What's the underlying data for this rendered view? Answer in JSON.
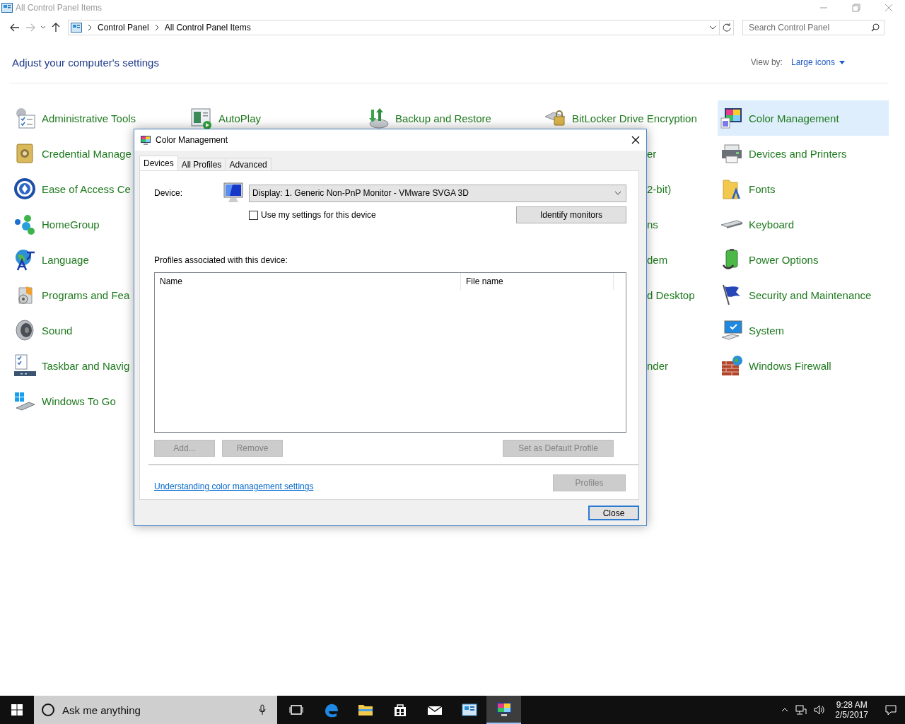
{
  "window": {
    "title": "All Control Panel Items"
  },
  "address_bar": {
    "breadcrumbs": [
      "Control Panel",
      "All Control Panel Items"
    ]
  },
  "search": {
    "placeholder": "Search Control Panel"
  },
  "heading": "Adjust your computer's settings",
  "view_by": {
    "label": "View by:",
    "value": "Large icons"
  },
  "rows": [
    {
      "cells": [
        {
          "label": "Administrative Tools",
          "kind": "item",
          "selected": false
        },
        {
          "label": "AutoPlay",
          "kind": "item",
          "selected": false
        },
        {
          "label": "Backup and Restore",
          "kind": "item",
          "selected": false
        },
        {
          "label": "BitLocker Drive Encryption",
          "kind": "item",
          "selected": false
        },
        {
          "label": "Color Management",
          "kind": "item",
          "selected": true
        }
      ]
    },
    {
      "cells": [
        {
          "label": "Credential Manage",
          "kind": "item",
          "selected": false
        },
        null,
        null,
        {
          "label": "er",
          "kind": "fragment",
          "selected": false
        },
        {
          "label": "Devices and Printers",
          "kind": "item",
          "selected": false
        }
      ]
    },
    {
      "cells": [
        {
          "label": "Ease of Access Ce",
          "kind": "item",
          "selected": false
        },
        null,
        null,
        {
          "label": "2-bit)",
          "kind": "fragment",
          "selected": false
        },
        {
          "label": "Fonts",
          "kind": "item",
          "selected": false
        }
      ]
    },
    {
      "cells": [
        {
          "label": "HomeGroup",
          "kind": "item",
          "selected": false
        },
        null,
        null,
        {
          "label": "ns",
          "kind": "fragment",
          "selected": false
        },
        {
          "label": "Keyboard",
          "kind": "item",
          "selected": false
        }
      ]
    },
    {
      "cells": [
        {
          "label": "Language",
          "kind": "item",
          "selected": false
        },
        null,
        null,
        {
          "label": "dem",
          "kind": "fragment",
          "selected": false
        },
        {
          "label": "Power Options",
          "kind": "item",
          "selected": false
        }
      ]
    },
    {
      "cells": [
        {
          "label": "Programs and Fea",
          "kind": "item",
          "selected": false
        },
        null,
        null,
        {
          "label": "d Desktop",
          "kind": "fragment",
          "selected": false
        },
        {
          "label": "Security and Maintenance",
          "kind": "item",
          "selected": false
        }
      ]
    },
    {
      "cells": [
        {
          "label": "Sound",
          "kind": "item",
          "selected": false
        },
        null,
        null,
        null,
        {
          "label": "System",
          "kind": "item",
          "selected": false
        }
      ]
    },
    {
      "cells": [
        {
          "label": "Taskbar and Navig",
          "kind": "item",
          "selected": false
        },
        null,
        null,
        {
          "label": "nder",
          "kind": "fragment",
          "selected": false
        },
        {
          "label": "Windows Firewall",
          "kind": "item",
          "selected": false
        }
      ]
    },
    {
      "cells": [
        {
          "label": "Windows To Go",
          "kind": "item",
          "selected": false
        }
      ]
    }
  ],
  "dialog": {
    "title": "Color Management",
    "tabs": [
      {
        "label": "Devices",
        "selected": true
      },
      {
        "label": "All Profiles",
        "selected": false
      },
      {
        "label": "Advanced",
        "selected": false
      }
    ],
    "device_label": "Device:",
    "device_select": {
      "value": "Display: 1. Generic Non-PnP Monitor - VMware SVGA 3D"
    },
    "use_my_settings": {
      "label": "Use my settings for this device",
      "checked": false
    },
    "identify_button": {
      "label": "Identify monitors",
      "disabled": false
    },
    "profiles_label": "Profiles associated with this device:",
    "profiles_table": {
      "columns": [
        "Name",
        "File name"
      ]
    },
    "buttons": [
      {
        "label": "Add...",
        "disabled": true
      },
      {
        "label": "Remove",
        "disabled": true
      },
      {
        "label": "Set as Default Profile",
        "disabled": true
      }
    ],
    "help_link": "Understanding color management settings",
    "profiles_button": {
      "label": "Profiles",
      "disabled": true
    },
    "close_button": {
      "label": "Close",
      "disabled": false
    }
  },
  "taskbar": {
    "search_placeholder": "Ask me anything",
    "apps": [
      {
        "selected": false
      },
      {
        "selected": false
      },
      {
        "selected": false
      },
      {
        "selected": false
      },
      {
        "selected": false
      },
      {
        "selected": false
      },
      {
        "selected": true
      }
    ],
    "clock": {
      "time": "9:28 AM",
      "date": "2/5/2017"
    }
  }
}
